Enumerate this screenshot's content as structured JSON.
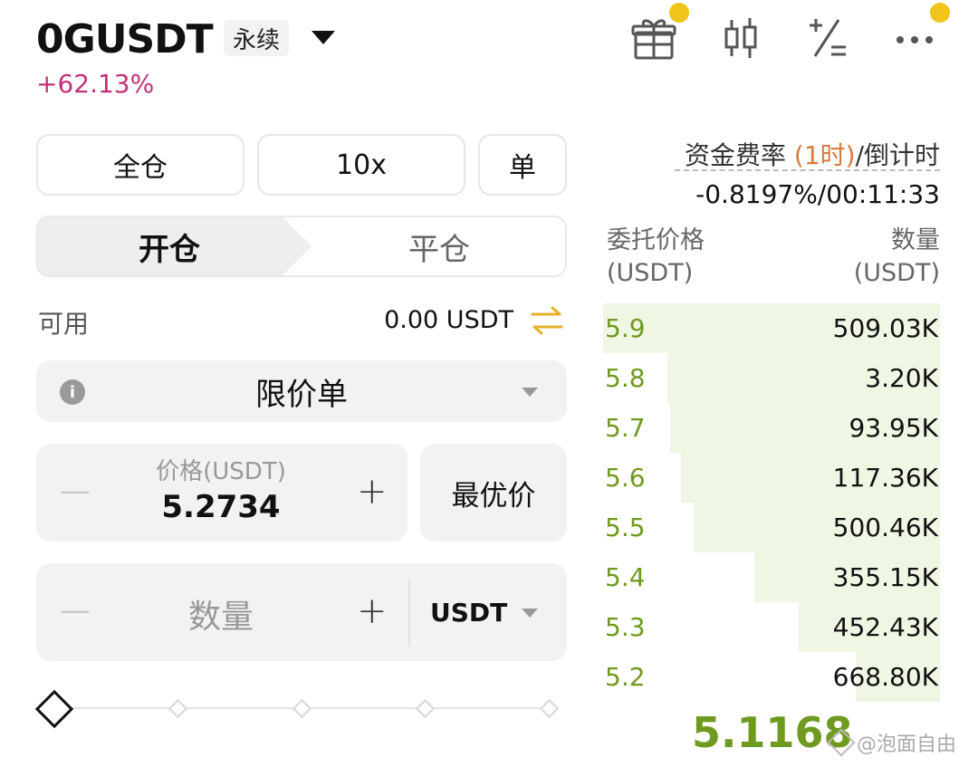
{
  "header": {
    "symbol": "0GUSDT",
    "contract_type": "永续",
    "change": "+62.13%",
    "icons": [
      "gift-icon",
      "candlestick-icon",
      "calculator-icon",
      "more-icon"
    ],
    "notification_color": "#f0c419"
  },
  "controls": {
    "margin_mode": "全仓",
    "leverage": "10x",
    "position_mode": "单"
  },
  "tabs": [
    {
      "label": "开仓",
      "active": true
    },
    {
      "label": "平仓",
      "active": false
    }
  ],
  "available": {
    "label": "可用",
    "value": "0.00 USDT"
  },
  "order_type": {
    "label": "限价单"
  },
  "price": {
    "label": "价格(USDT)",
    "value": "5.2734",
    "best_price_label": "最优价",
    "minus": "—",
    "plus": "+"
  },
  "quantity": {
    "placeholder": "数量",
    "unit": "USDT",
    "minus": "—",
    "plus": "+"
  },
  "slider": {
    "percent": 0
  },
  "funding": {
    "label_prefix": "资金费率 ",
    "label_accent": "(1时)",
    "label_suffix": "/倒计时",
    "value": "-0.8197%/00:11:33"
  },
  "orderbook": {
    "price_header": "委托价格",
    "price_unit": "(USDT)",
    "amount_header": "数量",
    "amount_unit": "(USDT)",
    "rows": [
      {
        "price": "5.9",
        "amount": "509.03K",
        "depth": 1.0
      },
      {
        "price": "5.8",
        "amount": "3.20K",
        "depth": 0.81
      },
      {
        "price": "5.7",
        "amount": "93.95K",
        "depth": 0.8
      },
      {
        "price": "5.6",
        "amount": "117.36K",
        "depth": 0.77
      },
      {
        "price": "5.5",
        "amount": "500.46K",
        "depth": 0.73
      },
      {
        "price": "5.4",
        "amount": "355.15K",
        "depth": 0.55
      },
      {
        "price": "5.3",
        "amount": "452.43K",
        "depth": 0.42
      },
      {
        "price": "5.2",
        "amount": "668.80K",
        "depth": 0.25
      }
    ],
    "last_price": "5.1168",
    "bid_color": "#6f9a1f",
    "depth_color": "#f0f6e4"
  },
  "watermark": {
    "text": "@泡面自由"
  }
}
